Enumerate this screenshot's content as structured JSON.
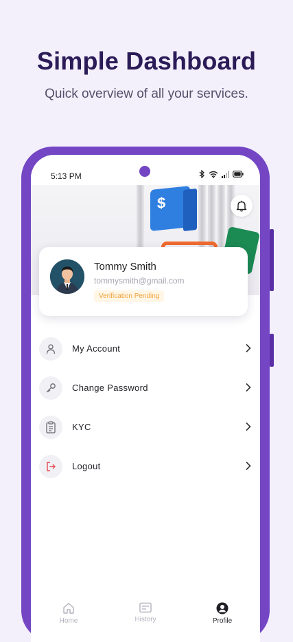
{
  "promo": {
    "headline": "Simple Dashboard",
    "subline": "Quick overview of all your services."
  },
  "status_bar": {
    "time": "5:13 PM",
    "icons": [
      "bluetooth-icon",
      "wifi-icon",
      "signal-icon",
      "battery-icon"
    ]
  },
  "banner": {
    "card_symbol": "$",
    "notification_icon": "bell-icon"
  },
  "profile": {
    "name": "Tommy Smith",
    "email": "tommysmith@gmail.com",
    "status_badge": "Verification Pending"
  },
  "menu": [
    {
      "label": "My Account",
      "icon": "user-icon"
    },
    {
      "label": "Change Password",
      "icon": "key-icon"
    },
    {
      "label": "KYC",
      "icon": "clipboard-icon"
    },
    {
      "label": "Logout",
      "icon": "logout-icon"
    }
  ],
  "bottom_nav": [
    {
      "label": "Home",
      "icon": "home-icon",
      "active": false
    },
    {
      "label": "History",
      "icon": "history-icon",
      "active": false
    },
    {
      "label": "Profile",
      "icon": "profile-icon",
      "active": true
    }
  ],
  "colors": {
    "accent": "#7446c4",
    "headline": "#2b1b57",
    "badge_text": "#f2a23b",
    "logout_icon": "#e5484d"
  }
}
